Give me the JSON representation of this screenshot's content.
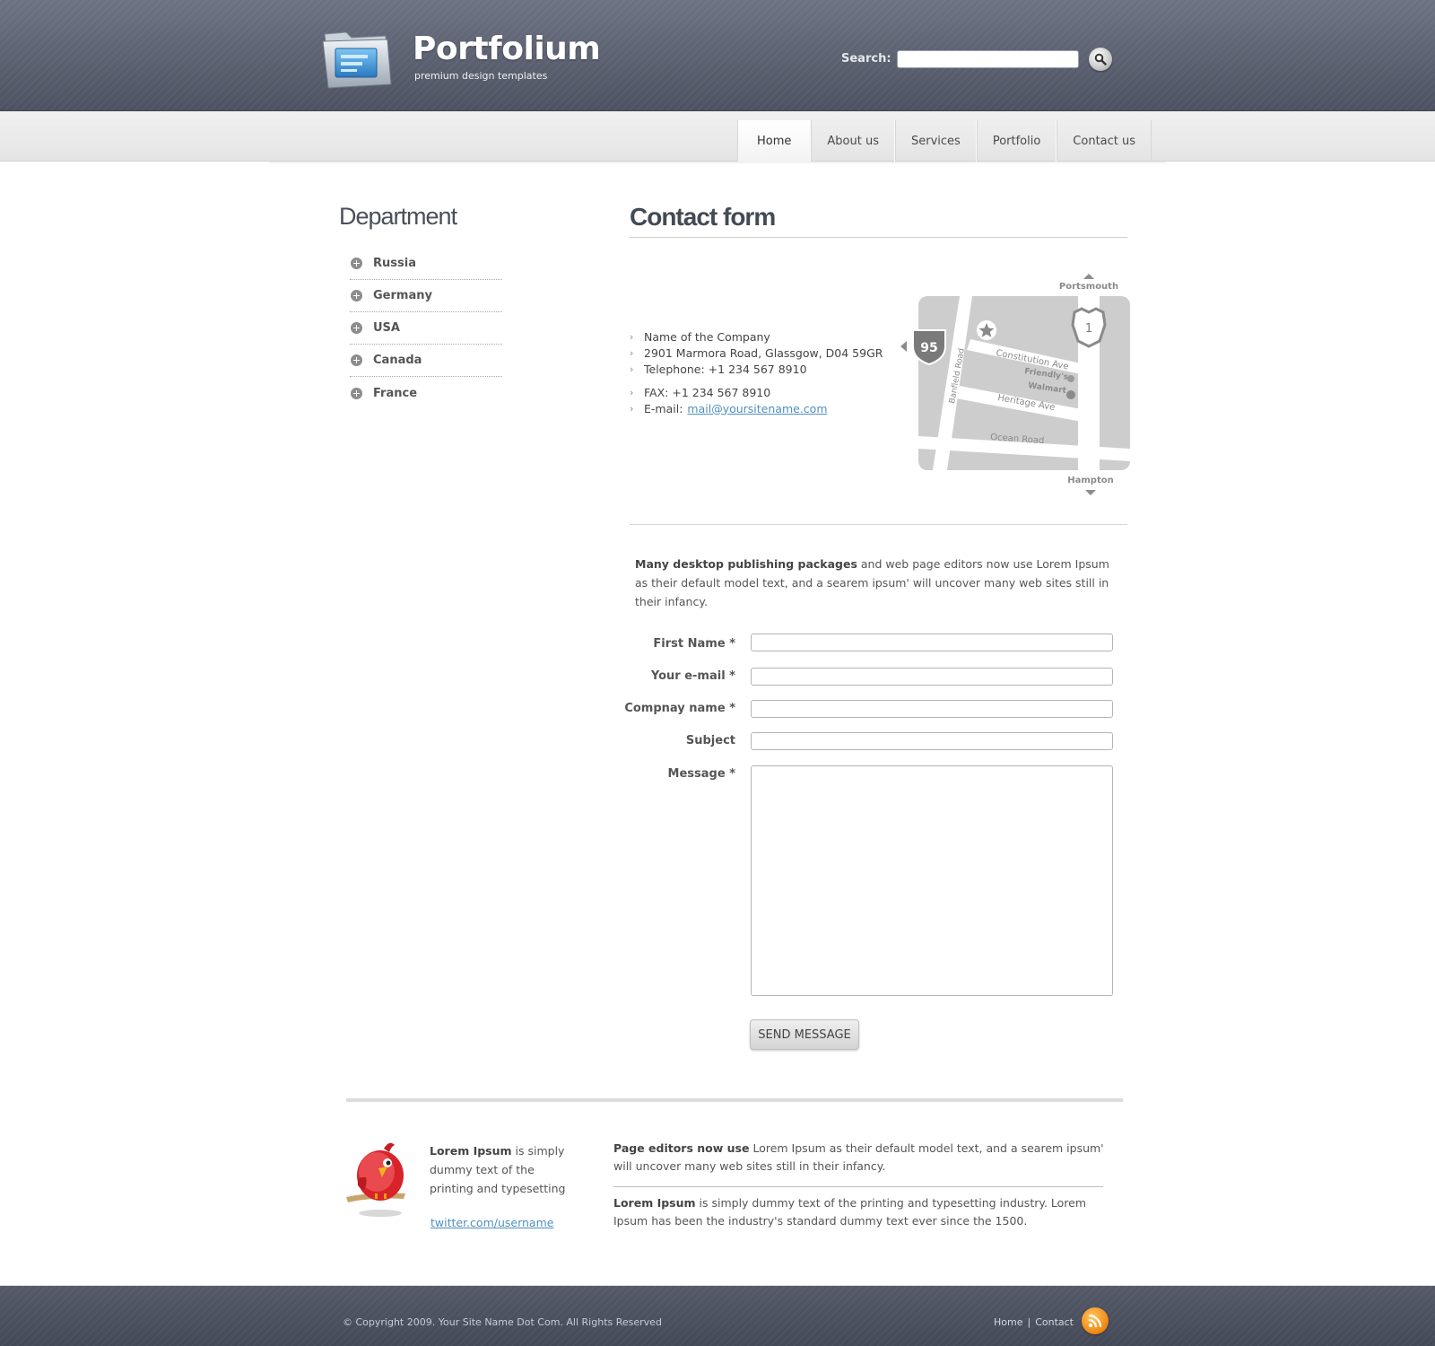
{
  "header": {
    "logo_title": "Portfolium",
    "logo_subtitle": "premium design templates",
    "search_label": "Search:",
    "search_value": "",
    "search_placeholder": ""
  },
  "nav": {
    "items": [
      {
        "label": "Home",
        "active": true
      },
      {
        "label": "About us",
        "active": false
      },
      {
        "label": "Services",
        "active": false
      },
      {
        "label": "Portfolio",
        "active": false
      },
      {
        "label": "Contact us",
        "active": false
      }
    ]
  },
  "sidebar": {
    "title": "Department",
    "items": [
      "Russia",
      "Germany",
      "USA",
      "Canada",
      "France"
    ]
  },
  "main": {
    "title": "Contact form",
    "contact": {
      "company": "Name of the Company",
      "address": "2901 Marmora Road, Glassgow, D04 59GR",
      "telephone": "Telephone: +1 234 567 8910",
      "fax": "FAX: +1 234 567 8910",
      "email_label": "E-mail:",
      "email": "mail@yoursitename.com"
    },
    "map": {
      "labels": {
        "north": "Portsmouth",
        "south": "Hampton",
        "interstate": "95",
        "route": "1",
        "road1": "Constitution Ave",
        "road2": "Heritage Ave",
        "road3": "Ocean Road",
        "road4": "Banfield Road",
        "poi1": "Friendly's",
        "poi2": "Walmart"
      }
    },
    "intro_bold": "Many desktop publishing packages",
    "intro_rest": " and web page editors now use Lorem Ipsum as their default model text, and a searem ipsum' will uncover many web sites still in their infancy.",
    "form": {
      "first_name_label": "First Name *",
      "email_label": "Your e-mail *",
      "company_label": "Compnay name *",
      "subject_label": "Subject",
      "message_label": "Message *",
      "first_name_value": "",
      "email_value": "",
      "company_value": "",
      "subject_value": "",
      "message_value": "",
      "submit_label": "SEND MESSAGE"
    }
  },
  "bottom": {
    "twitter_bold": "Lorem Ipsum",
    "twitter_text": " is simply dummy text of the printing and typesetting",
    "twitter_link": "twitter.com/username",
    "p1_bold": "Page editors now use",
    "p1_rest": " Lorem Ipsum as their default model text, and a searem ipsum' will uncover many web sites still in their infancy.",
    "p2_bold": "Lorem Ipsum",
    "p2_rest": " is simply dummy text of the printing and typesetting industry. Lorem Ipsum has been the industry's standard dummy text ever since the 1500."
  },
  "footer": {
    "copyright": "© Copyright 2009. Your Site Name Dot Com. All Rights Reserved",
    "links": [
      "Home",
      "Contact"
    ],
    "separator": "|",
    "rss_icon": "rss-icon"
  },
  "colors": {
    "header_bg": "#5c6271",
    "link": "#4f8fc0",
    "rss": "#f08a16"
  }
}
